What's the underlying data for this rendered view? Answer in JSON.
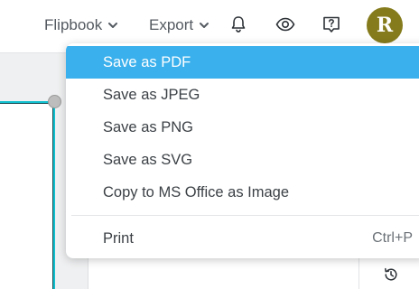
{
  "header": {
    "flipbook_label": "Flipbook",
    "export_label": "Export",
    "avatar_initial": "R",
    "icons": [
      "chevron-down-icon",
      "bell-icon",
      "eye-icon",
      "help-icon",
      "history-icon"
    ]
  },
  "export_menu": {
    "items": [
      {
        "label": "Save as PDF",
        "selected": true
      },
      {
        "label": "Save as JPEG",
        "selected": false
      },
      {
        "label": "Save as PNG",
        "selected": false
      },
      {
        "label": "Save as SVG",
        "selected": false
      },
      {
        "label": "Copy to MS Office as Image",
        "selected": false
      }
    ],
    "print": {
      "label": "Print",
      "shortcut": "Ctrl+P"
    }
  },
  "colors": {
    "accent": "#3ab0ec",
    "avatar": "#857b1c",
    "selection": "#11c0cf"
  }
}
